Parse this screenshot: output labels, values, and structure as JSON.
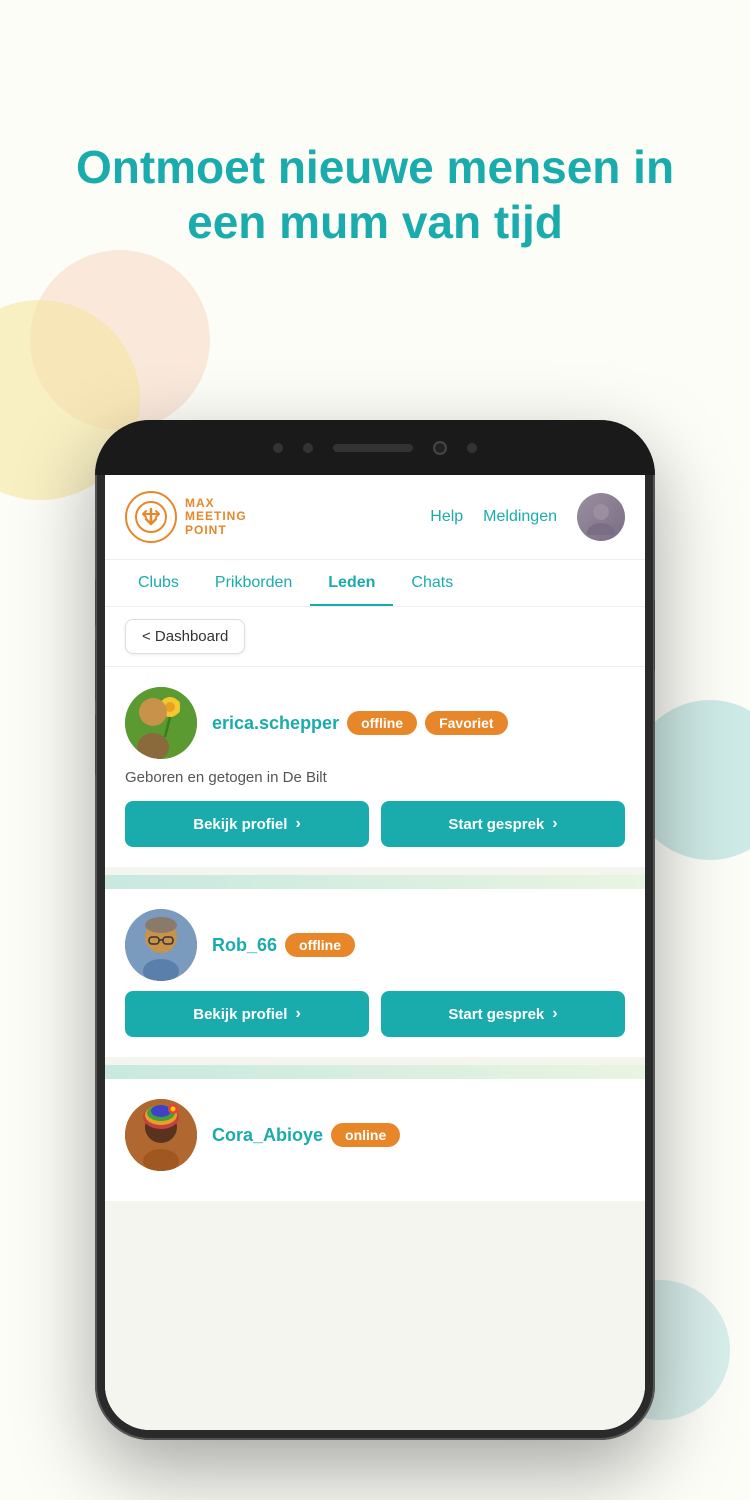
{
  "hero": {
    "heading_line1": "Ontmoet nieuwe mensen in",
    "heading_line2": "een mum van tijd"
  },
  "header": {
    "logo": {
      "line1": "MAX",
      "line2": "MEETING",
      "line3": "POINT"
    },
    "nav": {
      "help": "Help",
      "meldingen": "Meldingen"
    }
  },
  "nav_tabs": [
    {
      "label": "Clubs",
      "active": false
    },
    {
      "label": "Prikborden",
      "active": false
    },
    {
      "label": "Leden",
      "active": true
    },
    {
      "label": "Chats",
      "active": false
    }
  ],
  "breadcrumb": {
    "label": "< Dashboard"
  },
  "members": [
    {
      "name": "erica.schepper",
      "status": "offline",
      "badge": "Favoriet",
      "description": "Geboren en getogen in De Bilt",
      "btn1": "Bekijk profiel",
      "btn2": "Start gesprek",
      "avatar_type": "erica"
    },
    {
      "name": "Rob_66",
      "status": "offline",
      "badge": null,
      "description": null,
      "btn1": "Bekijk profiel",
      "btn2": "Start gesprek",
      "avatar_type": "rob"
    },
    {
      "name": "Cora_Abioye",
      "status": "online",
      "badge": null,
      "description": null,
      "btn1": null,
      "btn2": null,
      "avatar_type": "cora"
    }
  ],
  "icons": {
    "chevron_right": "›",
    "chevron_left": "‹"
  }
}
